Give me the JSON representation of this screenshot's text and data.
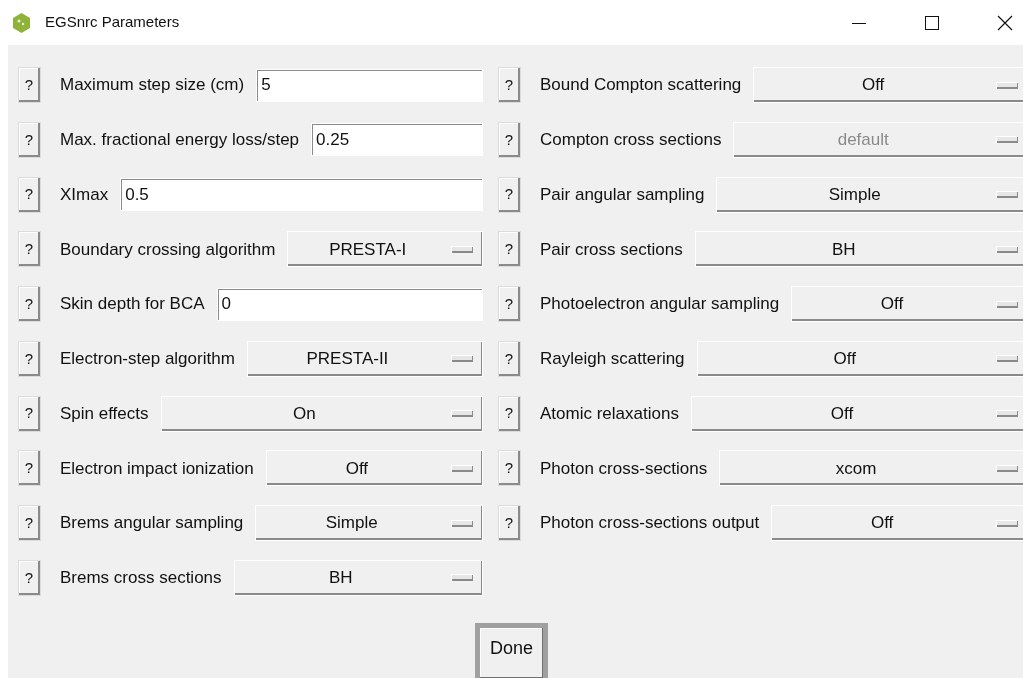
{
  "window": {
    "title": "EGSnrc Parameters"
  },
  "left": [
    {
      "kind": "entry",
      "help": "?",
      "label": "Maximum step size (cm)",
      "value": "5"
    },
    {
      "kind": "entry",
      "help": "?",
      "label": "Max. fractional energy loss/step",
      "value": "0.25"
    },
    {
      "kind": "entry",
      "help": "?",
      "label": "XImax",
      "value": "0.5"
    },
    {
      "kind": "menu",
      "help": "?",
      "label": "Boundary crossing algorithm",
      "value": "PRESTA-I",
      "disabled": false
    },
    {
      "kind": "entry",
      "help": "?",
      "label": "Skin depth for BCA",
      "value": "0"
    },
    {
      "kind": "menu",
      "help": "?",
      "label": "Electron-step algorithm",
      "value": "PRESTA-II",
      "disabled": false
    },
    {
      "kind": "menu",
      "help": "?",
      "label": "Spin effects",
      "value": "On",
      "disabled": false
    },
    {
      "kind": "menu",
      "help": "?",
      "label": "Electron impact ionization",
      "value": "Off",
      "disabled": false
    },
    {
      "kind": "menu",
      "help": "?",
      "label": "Brems angular sampling",
      "value": "Simple",
      "disabled": false
    },
    {
      "kind": "menu",
      "help": "?",
      "label": "Brems cross sections",
      "value": "BH",
      "disabled": false
    }
  ],
  "right": [
    {
      "kind": "menu",
      "help": "?",
      "label": "Bound Compton scattering",
      "value": "Off",
      "disabled": false
    },
    {
      "kind": "menu",
      "help": "?",
      "label": "Compton cross sections",
      "value": "default",
      "disabled": true
    },
    {
      "kind": "menu",
      "help": "?",
      "label": "Pair angular sampling",
      "value": "Simple",
      "disabled": false
    },
    {
      "kind": "menu",
      "help": "?",
      "label": "Pair cross sections",
      "value": "BH",
      "disabled": false
    },
    {
      "kind": "menu",
      "help": "?",
      "label": "Photoelectron angular sampling",
      "value": "Off",
      "disabled": false
    },
    {
      "kind": "menu",
      "help": "?",
      "label": "Rayleigh scattering",
      "value": "Off",
      "disabled": false
    },
    {
      "kind": "menu",
      "help": "?",
      "label": "Atomic relaxations",
      "value": "Off",
      "disabled": false
    },
    {
      "kind": "menu",
      "help": "?",
      "label": "Photon cross-sections",
      "value": "xcom",
      "disabled": false
    },
    {
      "kind": "menu",
      "help": "?",
      "label": "Photon cross-sections output",
      "value": "Off",
      "disabled": false
    }
  ],
  "done_button": "Done"
}
